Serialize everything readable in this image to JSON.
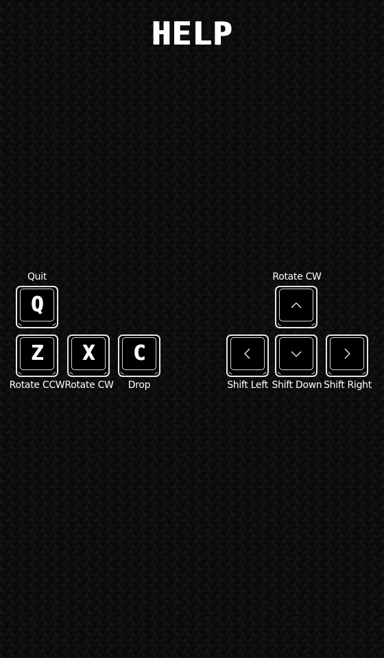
{
  "title": "HELP",
  "keys": {
    "q": {
      "letter": "Q",
      "label": "Quit"
    },
    "z": {
      "letter": "Z",
      "label": "Rotate CCW"
    },
    "x": {
      "letter": "X",
      "label": "Rotate CW"
    },
    "c": {
      "letter": "C",
      "label": "Drop"
    },
    "up": {
      "icon": "arrow-up-icon",
      "label": "Rotate CW"
    },
    "left": {
      "icon": "arrow-left-icon",
      "label": "Shift Left"
    },
    "down": {
      "icon": "arrow-down-icon",
      "label": "Shift Down"
    },
    "right": {
      "icon": "arrow-right-icon",
      "label": "Shift Right"
    }
  },
  "colors": {
    "background": "#0d0d0d",
    "foreground": "#ffffff"
  }
}
